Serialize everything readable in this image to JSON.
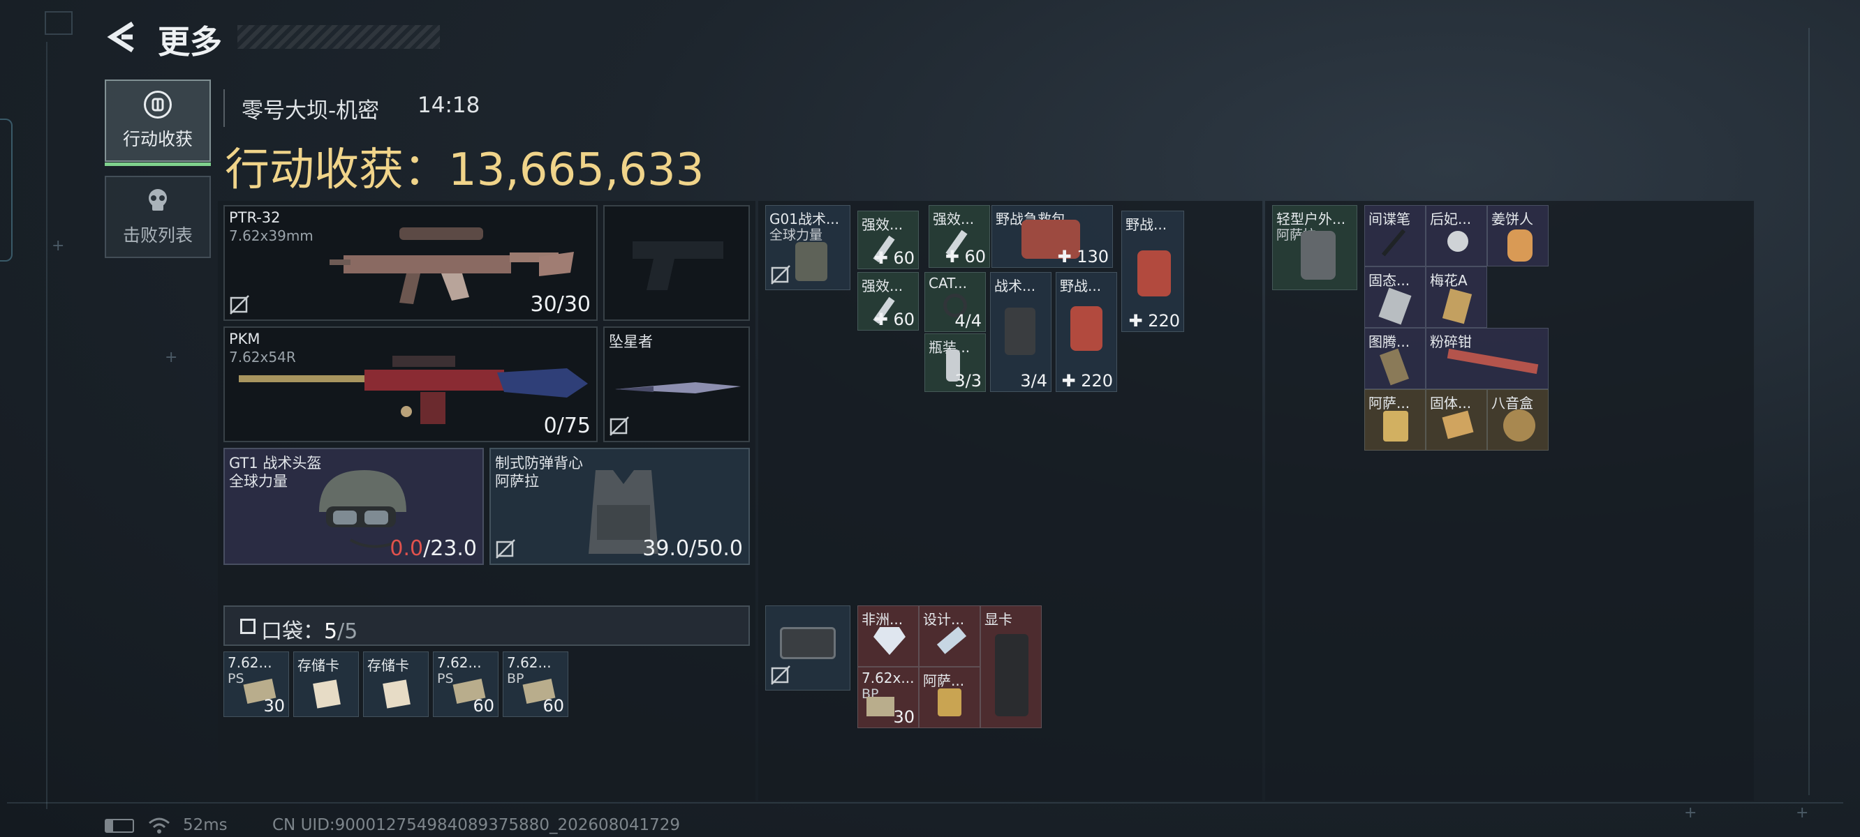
{
  "header": {
    "title": "更多"
  },
  "tabs": [
    {
      "label": "行动收获",
      "icon": "loot-icon",
      "active": true
    },
    {
      "label": "击败列表",
      "icon": "skull-icon",
      "active": false
    }
  ],
  "match": {
    "map": "零号大坝-机密",
    "time": "14:18"
  },
  "summary": {
    "label": "行动收获：",
    "value": "13,665,633",
    "color": "#f0d48a"
  },
  "weapons": [
    {
      "name": "PTR-32",
      "caliber": "7.62x39mm",
      "ammo": "30/30"
    },
    {
      "name": "PKM",
      "caliber": "7.62x54R",
      "ammo": "0/75"
    }
  ],
  "melee": {
    "name": "坠星者"
  },
  "helmet": {
    "name": "GT1 战术头盔",
    "brand": "全球力量",
    "durability": "0.0",
    "max": "/23.0",
    "durability_color": "#e0524d"
  },
  "armor": {
    "name": "制式防弹背心",
    "brand": "阿萨拉",
    "durability": "39.0/50.0"
  },
  "pocket": {
    "label": "口袋：",
    "used": "5",
    "total": "/5"
  },
  "pocket_items": [
    {
      "name": "7.62...",
      "sub": "PS",
      "count": "30"
    },
    {
      "name": "存储卡",
      "sub": "",
      "count": ""
    },
    {
      "name": "存储卡",
      "sub": "",
      "count": ""
    },
    {
      "name": "7.62...",
      "sub": "PS",
      "count": "60"
    },
    {
      "name": "7.62...",
      "sub": "BP",
      "count": "60"
    }
  ],
  "chest_rig": {
    "name": "G01战术...",
    "brand": "全球力量"
  },
  "rig_items": [
    {
      "name": "强效...",
      "count": "60"
    },
    {
      "name": "强效...",
      "count": "60"
    },
    {
      "name": "强效...",
      "count": "60"
    },
    {
      "name": "野战急救包",
      "count": "130"
    },
    {
      "name": "野战...",
      "count": "220"
    },
    {
      "name": "CAT...",
      "count": "4/4"
    },
    {
      "name": "瓶装...",
      "count": "3/3"
    },
    {
      "name": "战术...",
      "count": "3/4"
    },
    {
      "name": "野战...",
      "count": "220"
    }
  ],
  "safe_box_items": [
    {
      "name": "非洲...",
      "count": ""
    },
    {
      "name": "设计...",
      "count": ""
    },
    {
      "name": "显卡",
      "count": ""
    },
    {
      "name": "7.62x...",
      "sub": "BP",
      "count": "30"
    },
    {
      "name": "阿萨...",
      "count": ""
    }
  ],
  "backpack": {
    "name": "轻型户外...",
    "brand": "阿萨拉"
  },
  "backpack_items": [
    {
      "name": "间谍笔"
    },
    {
      "name": "后妃..."
    },
    {
      "name": "姜饼人"
    },
    {
      "name": "固态..."
    },
    {
      "name": "梅花A"
    },
    {
      "name": "图腾..."
    },
    {
      "name": "粉碎钳"
    },
    {
      "name": "阿萨..."
    },
    {
      "name": "固体..."
    },
    {
      "name": "八音盒"
    }
  ],
  "status_bar": {
    "ping": "52ms",
    "uid": "CN UID:900012754984089375880_202608041729"
  }
}
